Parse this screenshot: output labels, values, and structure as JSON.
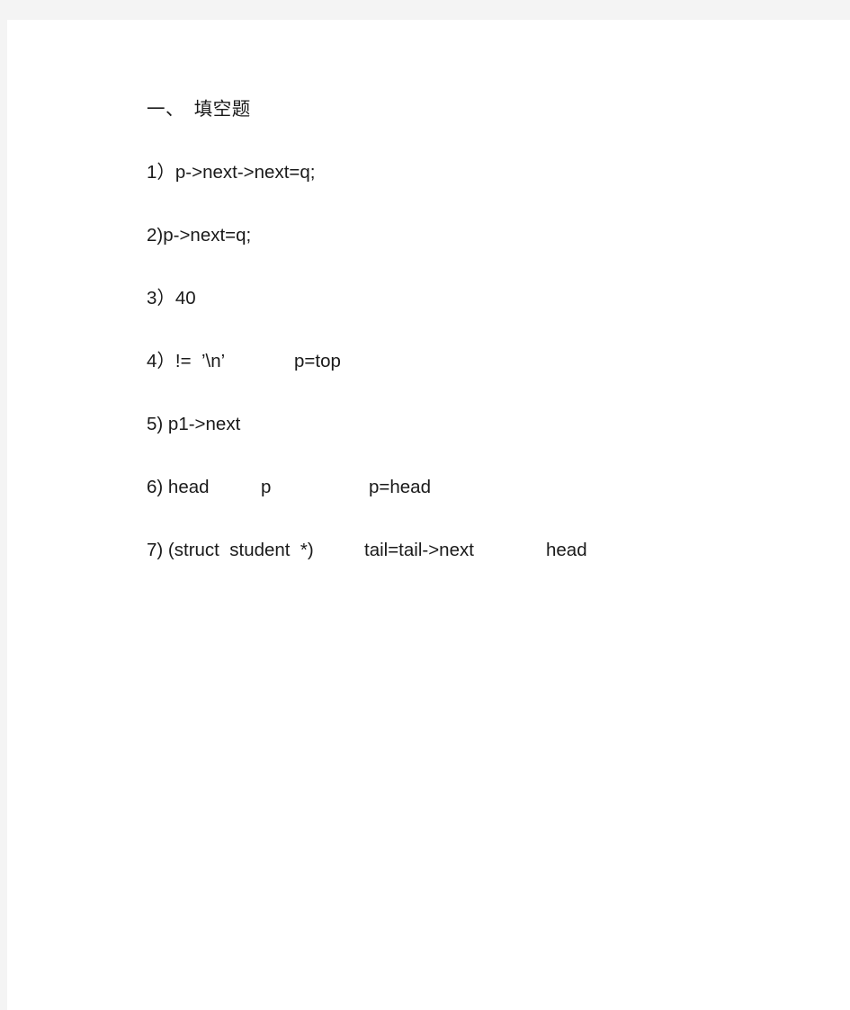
{
  "page": {
    "background_color": "#f4f4f4",
    "sheet_color": "#ffffff",
    "text_color": "#1a1a1a"
  },
  "document": {
    "heading": "一、　填空题",
    "lines": [
      {
        "name": "answer-line-1",
        "segments": [
          "1）p->next->next=q;"
        ]
      },
      {
        "name": "answer-line-2",
        "segments": [
          "2)p->next=q;"
        ]
      },
      {
        "name": "answer-line-3",
        "segments": [
          "3）40"
        ]
      },
      {
        "name": "answer-line-4",
        "segments": [
          "4）!=  ’\\n’",
          "p=top"
        ]
      },
      {
        "name": "answer-line-5",
        "segments": [
          "5) p1->next"
        ]
      },
      {
        "name": "answer-line-6",
        "segments": [
          "6) head",
          "p",
          "p=head"
        ]
      },
      {
        "name": "answer-line-7",
        "segments": [
          "7) (struct  student  *)",
          "tail=tail->next",
          "head"
        ]
      }
    ]
  }
}
